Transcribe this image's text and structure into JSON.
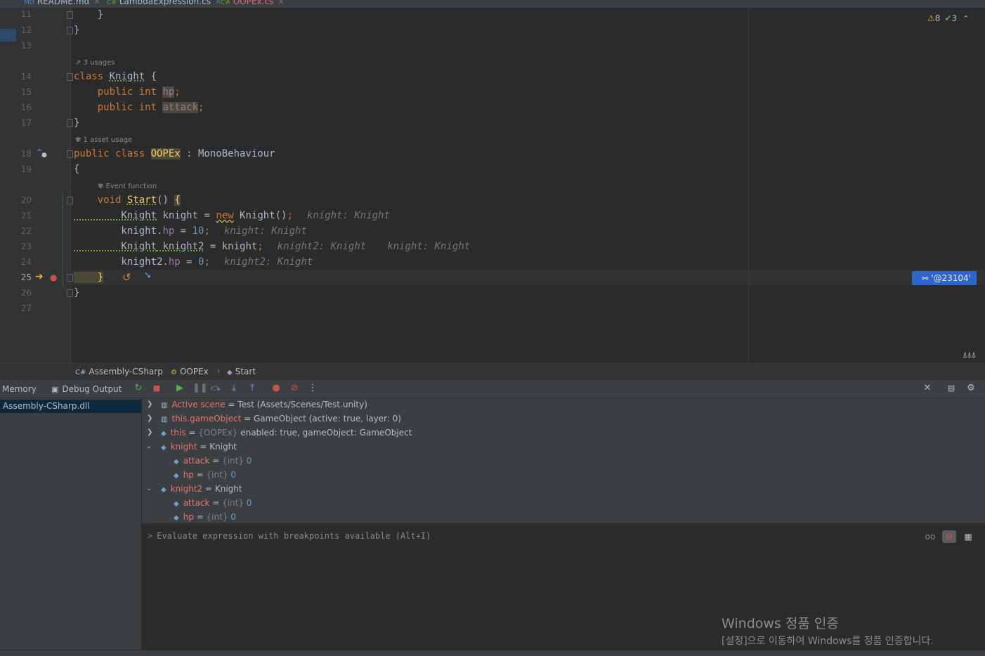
{
  "tabs": [
    {
      "label": "README.md",
      "icon": "markdown-icon"
    },
    {
      "label": "LambdaExpression.cs",
      "icon": "csharp-file-icon"
    },
    {
      "label": "OOPEx.cs",
      "icon": "csharp-file-icon",
      "active": true
    }
  ],
  "inspections": {
    "warnings": "8",
    "ok": "3"
  },
  "editor": {
    "line_numbers": [
      "11",
      "12",
      "13",
      "14",
      "15",
      "16",
      "17",
      "18",
      "19",
      "20",
      "21",
      "22",
      "23",
      "24",
      "25",
      "26",
      "27"
    ],
    "current_line": "25",
    "lens_usages": "3 usages",
    "lens_asset_usage": "1 asset usage",
    "lens_event_function": "Event function",
    "code": {
      "l11": "    }",
      "l12": "}",
      "l14_kw": "class ",
      "l14_name": "Knight",
      "l14_rest": " {",
      "l15_kw": "    public int ",
      "l15_field": "hp",
      "l15_end": ";",
      "l16_kw": "    public int ",
      "l16_field": "attack",
      "l16_end": ";",
      "l17": "}",
      "l18_kw": "public class ",
      "l18_name": "OOPEx",
      "l18_rest": " : MonoBehaviour",
      "l19": "{",
      "l20_kw": "    void ",
      "l20_fn": "Start",
      "l20_rest": "() ",
      "l20_brace": "{",
      "l21_type": "        Knight",
      "l21_rest": " knight = ",
      "l21_new": "new",
      "l21_ctor": " Knight()",
      "l21_end": ";",
      "l21_hint": "knight: Knight",
      "l22_a": "        knight.",
      "l22_field": "hp",
      "l22_b": " = ",
      "l22_num": "10",
      "l22_end": ";",
      "l22_hint": "knight: Knight",
      "l23_type": "        Knight",
      "l23_var": " knight2",
      "l23_rest": " = knight",
      "l23_end": ";",
      "l23_hint1": "knight2: Knight",
      "l23_hint2": "knight: Knight",
      "l24_a": "        knight2.",
      "l24_field": "hp",
      "l24_b": " = ",
      "l24_num": "0",
      "l24_end": ";",
      "l24_hint": "knight2: Knight",
      "l25": "    }",
      "l26": "}"
    },
    "address_badge": "'@23104'"
  },
  "breadcrumb": [
    {
      "label": "Assembly-CSharp",
      "icon": "csharp-project-icon"
    },
    {
      "label": "OOPEx",
      "icon": "class-icon"
    },
    {
      "label": "Start",
      "icon": "method-icon"
    }
  ],
  "debug": {
    "tab_memory": "Memory",
    "tab_output": "Debug Output",
    "frame": "Assembly-CSharp.dll",
    "variables": [
      {
        "name": "Active scene",
        "eq": " = ",
        "value": "Test (Assets/Scenes/Test.unity)",
        "expanded": false
      },
      {
        "name": "this.gameObject",
        "eq": " = ",
        "value": "GameObject (active: true, layer: 0)",
        "expanded": false
      },
      {
        "name": "this",
        "eq": " = ",
        "type": "{OOPEx}",
        "value": " enabled: true, gameObject: GameObject",
        "expanded": false
      },
      {
        "name": "knight",
        "eq": " = ",
        "value": "Knight",
        "expanded": true
      },
      {
        "name": "attack",
        "eq": " = ",
        "type": "{int}",
        "value": " 0"
      },
      {
        "name": "hp",
        "eq": " = ",
        "type": "{int}",
        "value": " 0"
      },
      {
        "name": "knight2",
        "eq": " = ",
        "value": "Knight",
        "expanded": true
      },
      {
        "name": "attack",
        "eq": " = ",
        "type": "{int}",
        "value": " 0"
      },
      {
        "name": "hp",
        "eq": " = ",
        "type": "{int}",
        "value": " 0"
      }
    ],
    "eval_placeholder": "Evaluate expression with breakpoints available (Alt+I)"
  },
  "watermark": {
    "line1": "Windows 정품 인증",
    "line2": "[설정]으로 이동하여 Windows를 정품 인증합니다."
  },
  "colors": {
    "accent": "#2f65ca",
    "keyword": "#cc7832",
    "variable_name": "#e57373"
  }
}
